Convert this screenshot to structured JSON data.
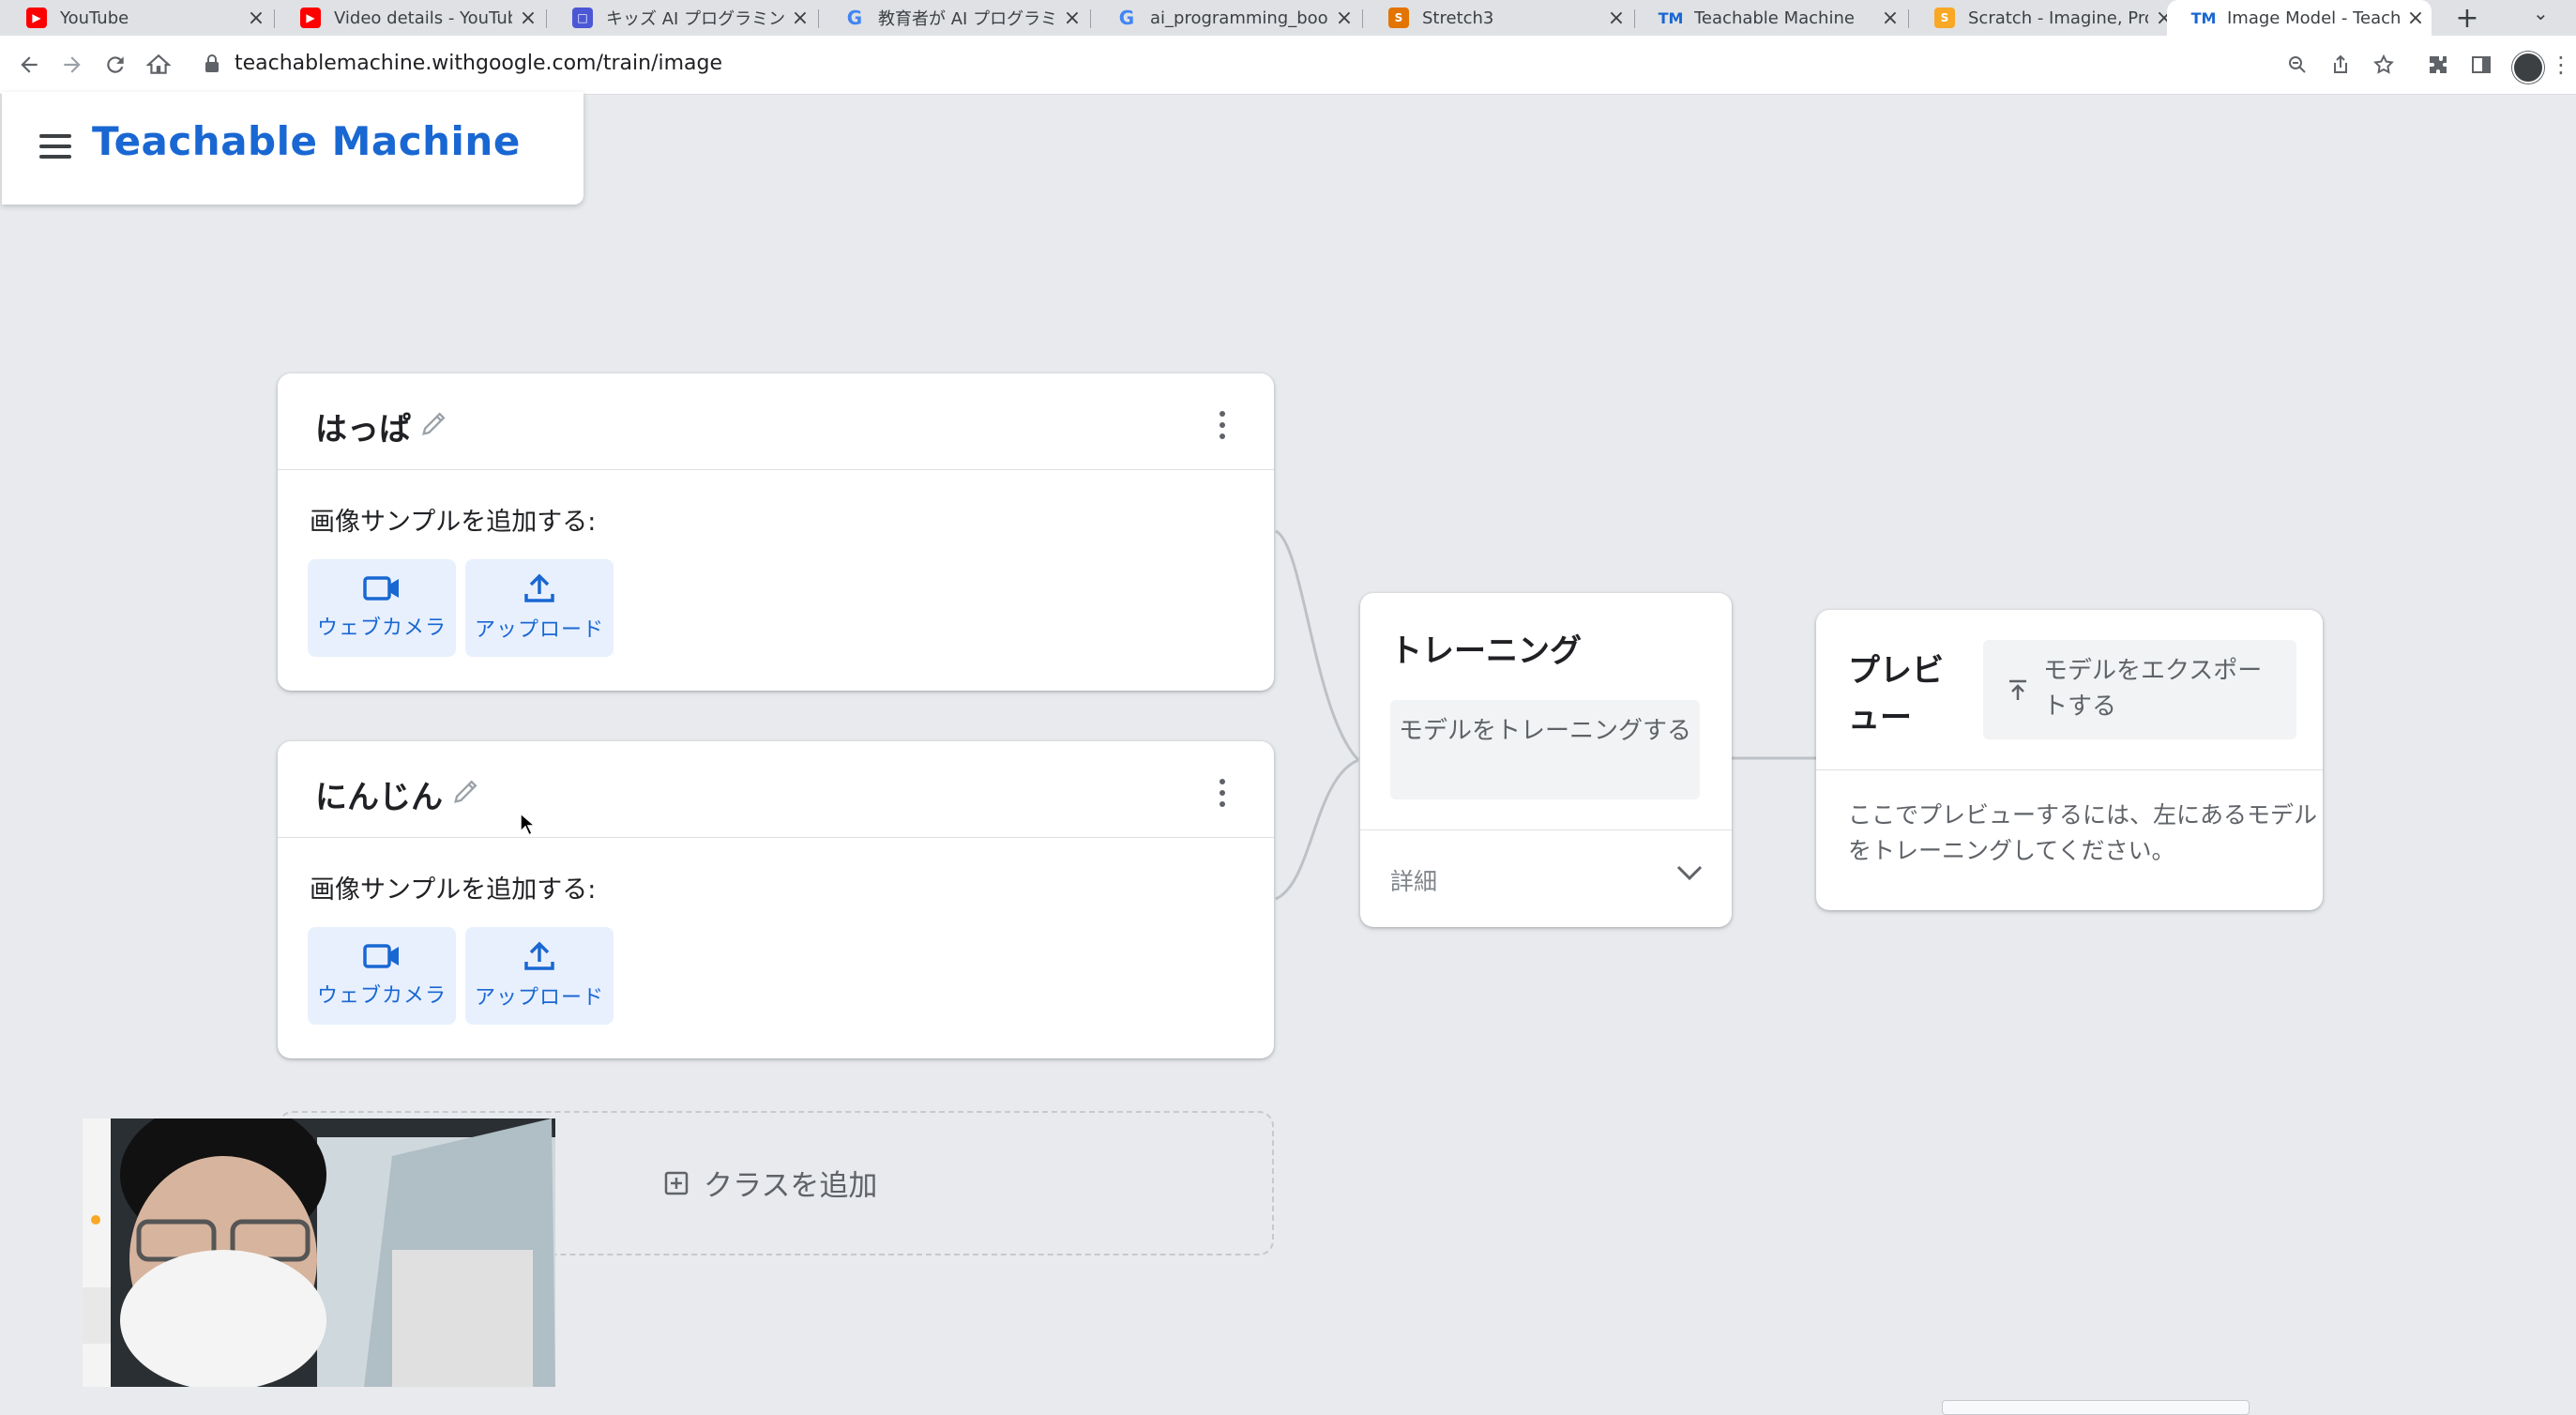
{
  "browser": {
    "tabs": [
      {
        "title": "YouTube",
        "icon": "youtube-icon",
        "color": "#ff0000"
      },
      {
        "title": "Video details - YouTube",
        "icon": "youtube-icon",
        "color": "#ff0000"
      },
      {
        "title": "キッズ AI プログラミング",
        "icon": "page-icon",
        "color": "#4c57d6"
      },
      {
        "title": "教育者が AI プログラミン",
        "icon": "google-icon",
        "color": "#4285f4"
      },
      {
        "title": "ai_programming_bookle",
        "icon": "google-icon",
        "color": "#4285f4"
      },
      {
        "title": "Stretch3",
        "icon": "stretch-icon",
        "color": "#e37400"
      },
      {
        "title": "Teachable Machine",
        "icon": "tm-icon",
        "color": "#1967d2"
      },
      {
        "title": "Scratch - Imagine, Prog",
        "icon": "scratch-icon",
        "color": "#f9a825"
      },
      {
        "title": "Image Model - Teachab",
        "icon": "tm-icon",
        "color": "#1967d2",
        "active": true
      }
    ],
    "url": "teachablemachine.withgoogle.com/train/image"
  },
  "app": {
    "title": "Teachable Machine",
    "accent_color": "#1967d2"
  },
  "classes": [
    {
      "name": "はっぱ",
      "samples_label": "画像サンプルを追加する:",
      "webcam_label": "ウェブカメラ",
      "upload_label": "アップロード"
    },
    {
      "name": "にんじん",
      "samples_label": "画像サンプルを追加する:",
      "webcam_label": "ウェブカメラ",
      "upload_label": "アップロード"
    }
  ],
  "add_class_label": "クラスを追加",
  "training": {
    "title": "トレーニング",
    "train_button": "モデルをトレーニングする",
    "details_label": "詳細"
  },
  "preview": {
    "title": "プレビュー",
    "export_button": "モデルをエクスポートする",
    "message": "ここでプレビューするには、左にあるモデルをトレーニングしてください。"
  }
}
